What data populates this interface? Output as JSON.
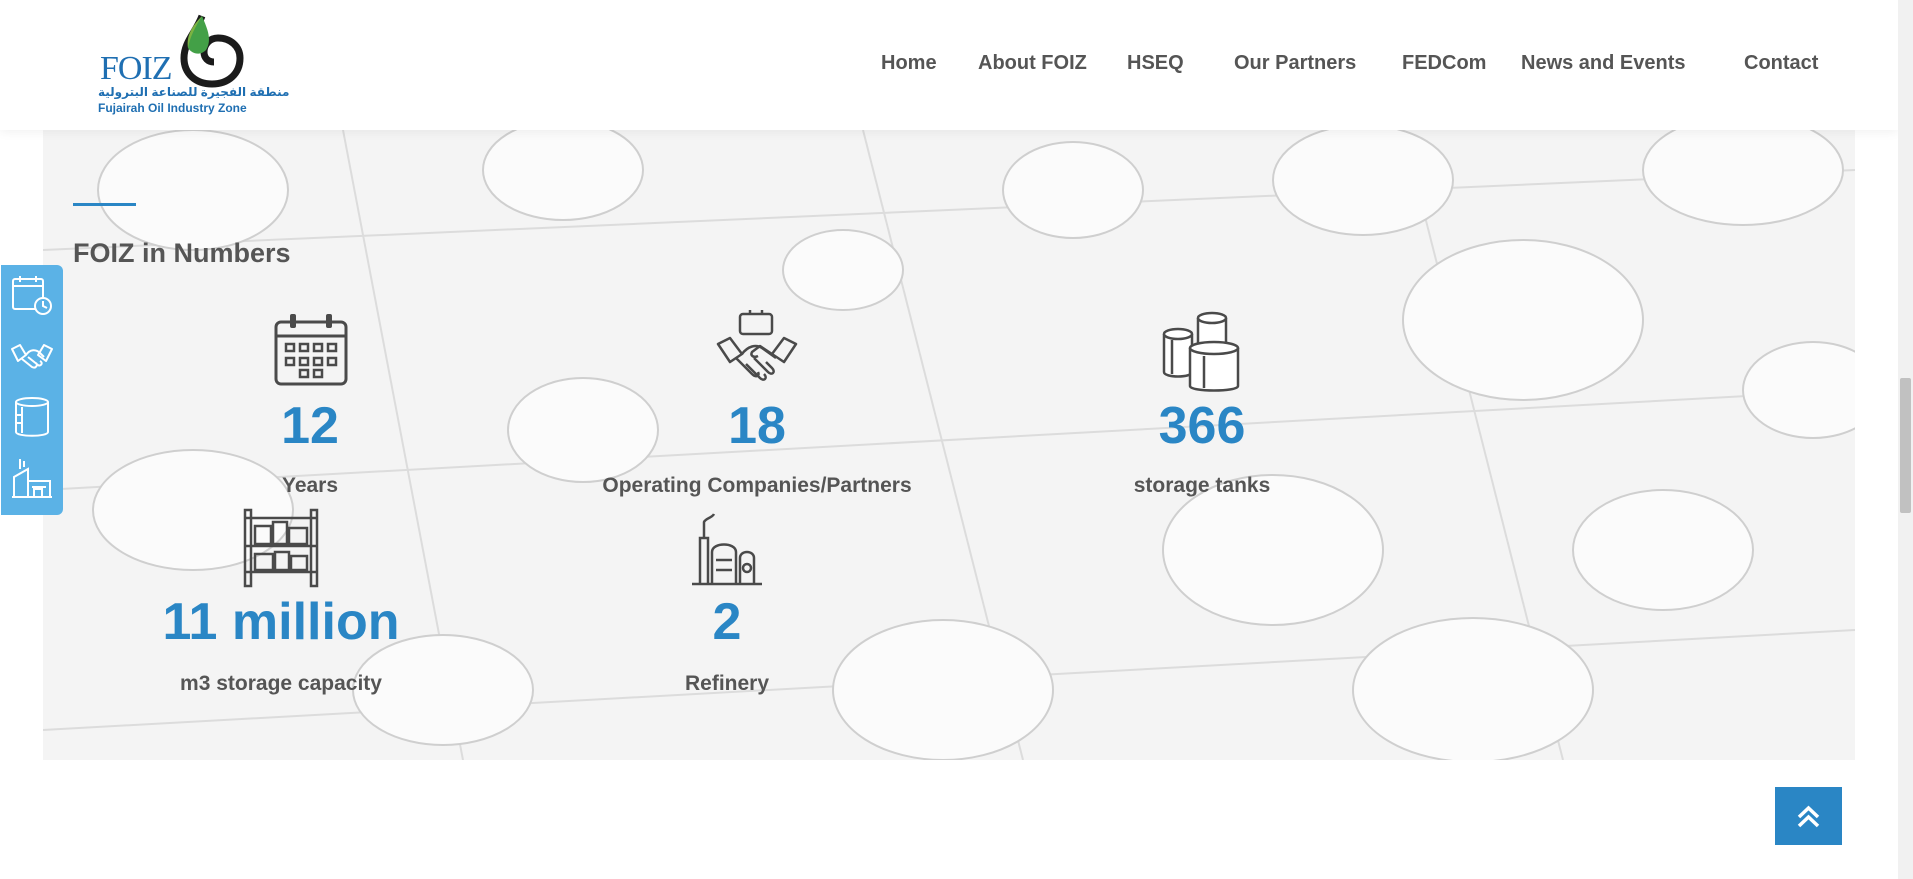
{
  "logo": {
    "text": "FOIZ",
    "arabic": "منطقة الفجيرة للصناعة البترولية",
    "english": "Fujairah Oil Industry Zone"
  },
  "nav": {
    "items": [
      "Home",
      "About FOIZ",
      "HSEQ",
      "Our Partners",
      "FEDCom",
      "News and Events",
      "Contact"
    ]
  },
  "section": {
    "title": "FOIZ in Numbers"
  },
  "stats": [
    {
      "number": "12",
      "label": "Years",
      "icon": "calendar-icon"
    },
    {
      "number": "18",
      "label": "Operating Companies/Partners",
      "icon": "handshake-icon"
    },
    {
      "number": "366",
      "label": "storage tanks",
      "icon": "storage-tanks-icon"
    },
    {
      "number": "11 million",
      "label": "m3 storage capacity",
      "icon": "warehouse-shelf-icon"
    },
    {
      "number": "2",
      "label": "Refinery",
      "icon": "refinery-icon"
    }
  ],
  "sidebar": {
    "items": [
      "calendar-clock-icon",
      "handshake-icon",
      "tank-icon",
      "refinery-icon"
    ]
  },
  "colors": {
    "accent": "#2a86c5",
    "sidebar": "#5bb2e6",
    "text": "#555555"
  }
}
